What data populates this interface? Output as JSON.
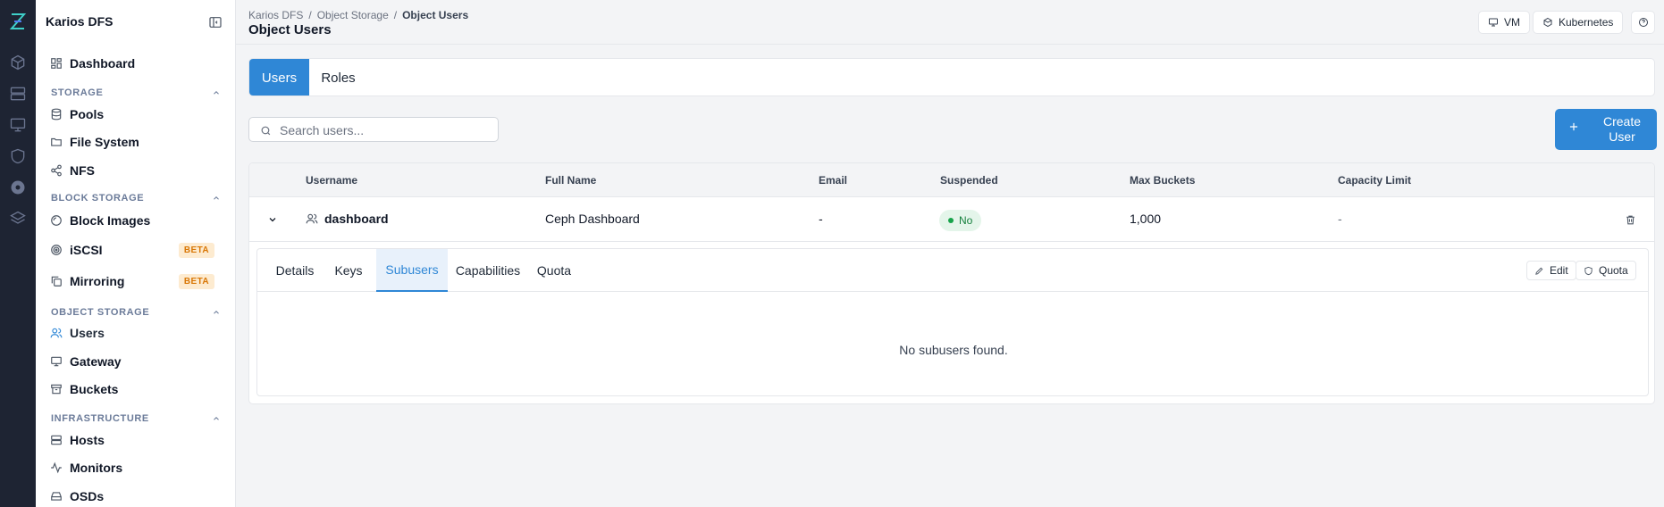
{
  "app": {
    "title": "Karios DFS"
  },
  "sidebar": {
    "dashboard": "Dashboard",
    "sections": {
      "storage": "STORAGE",
      "block": "BLOCK STORAGE",
      "object": "OBJECT STORAGE",
      "infra": "INFRASTRUCTURE"
    },
    "items": {
      "pools": "Pools",
      "filesystem": "File System",
      "nfs": "NFS",
      "block_images": "Block Images",
      "iscsi": "iSCSI",
      "mirroring": "Mirroring",
      "users": "Users",
      "gateway": "Gateway",
      "buckets": "Buckets",
      "hosts": "Hosts",
      "monitors": "Monitors",
      "osds": "OSDs"
    },
    "beta_label": "BETA"
  },
  "header": {
    "breadcrumb": [
      "Karios DFS",
      "Object Storage",
      "Object Users"
    ],
    "sep": "/",
    "title": "Object Users",
    "vm": "VM",
    "kubernetes": "Kubernetes"
  },
  "tabs": [
    "Users",
    "Roles"
  ],
  "search": {
    "placeholder": "Search users..."
  },
  "create_button": "Create User",
  "table": {
    "columns": [
      "Username",
      "Full Name",
      "Email",
      "Suspended",
      "Max Buckets",
      "Capacity Limit"
    ],
    "rows": [
      {
        "username": "dashboard",
        "full_name": "Ceph Dashboard",
        "email": "-",
        "suspended": "No",
        "max_buckets": "1,000",
        "capacity": "-"
      }
    ]
  },
  "detail": {
    "tabs": [
      "Details",
      "Keys",
      "Subusers",
      "Capabilities",
      "Quota"
    ],
    "active_tab": "Subusers",
    "edit": "Edit",
    "quota": "Quota",
    "empty": "No subusers found."
  },
  "colors": {
    "accent": "#2f87d6",
    "rail": "#1e2433",
    "beta_text": "#d97706",
    "beta_bg": "#fdebd0",
    "success": "#15803d"
  }
}
